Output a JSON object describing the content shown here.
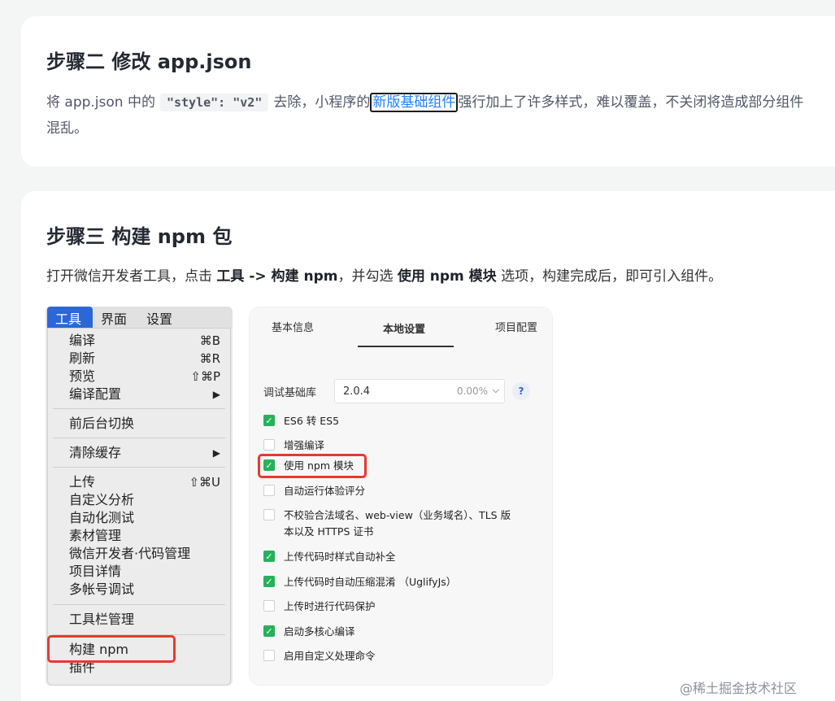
{
  "step2": {
    "title": "步骤二 修改 app.json",
    "p_pre": "将 app.json 中的",
    "code": "\"style\": \"v2\"",
    "p_mid": "去除，小程序的",
    "link": "新版基础组件",
    "p_post": "强行加上了许多样式，难以覆盖，不关闭将造成部分组件",
    "p_line2": "混乱。"
  },
  "step3": {
    "title": "步骤三 构建 npm 包",
    "p_1": "打开微信开发者工具，点击 ",
    "p_bold1": "工具 -> 构建 npm",
    "p_2": "，并勾选 ",
    "p_bold2": "使用 npm 模块",
    "p_3": " 选项，构建完成后，即可引入组件。"
  },
  "menu": {
    "bar": [
      "工具",
      "界面",
      "设置"
    ],
    "items": [
      {
        "label": "编译",
        "shortcut": "⌘B"
      },
      {
        "label": "刷新",
        "shortcut": "⌘R"
      },
      {
        "label": "预览",
        "shortcut": "⇧⌘P"
      },
      {
        "label": "编译配置",
        "shortcut": "▶"
      },
      {
        "label": "前后台切换",
        "shortcut": ""
      },
      {
        "label": "清除缓存",
        "shortcut": "▶"
      },
      {
        "label": "上传",
        "shortcut": "⇧⌘U"
      },
      {
        "label": "自定义分析",
        "shortcut": ""
      },
      {
        "label": "自动化测试",
        "shortcut": ""
      },
      {
        "label": "素材管理",
        "shortcut": ""
      },
      {
        "label": "微信开发者·代码管理",
        "shortcut": ""
      },
      {
        "label": "项目详情",
        "shortcut": ""
      },
      {
        "label": "多帐号调试",
        "shortcut": ""
      },
      {
        "label": "工具栏管理",
        "shortcut": ""
      },
      {
        "label": "构建 npm",
        "shortcut": ""
      },
      {
        "label": "插件",
        "shortcut": ""
      }
    ]
  },
  "settings": {
    "tabs": [
      "基本信息",
      "本地设置",
      "项目配置"
    ],
    "debug_label": "调试基础库",
    "debug_version": "2.0.4",
    "debug_percent": "0.00%",
    "help": "?",
    "options": [
      {
        "label": "ES6 转 ES5",
        "checked": true
      },
      {
        "label": "增强编译",
        "checked": false
      },
      {
        "label": "使用 npm 模块",
        "checked": true
      },
      {
        "label": "自动运行体验评分",
        "checked": false
      },
      {
        "label": "不校验合法域名、web-view（业务域名）、TLS 版",
        "label2": "本以及 HTTPS 证书",
        "checked": false
      },
      {
        "label": "上传代码时样式自动补全",
        "checked": true
      },
      {
        "label": "上传代码时自动压缩混淆 （UglifyJs）",
        "checked": true
      },
      {
        "label": "上传时进行代码保护",
        "checked": false
      },
      {
        "label": "启动多核心编译",
        "checked": true
      },
      {
        "label": "启用自定义处理命令",
        "checked": false
      }
    ]
  },
  "watermark": "@稀土掘金技术社区"
}
